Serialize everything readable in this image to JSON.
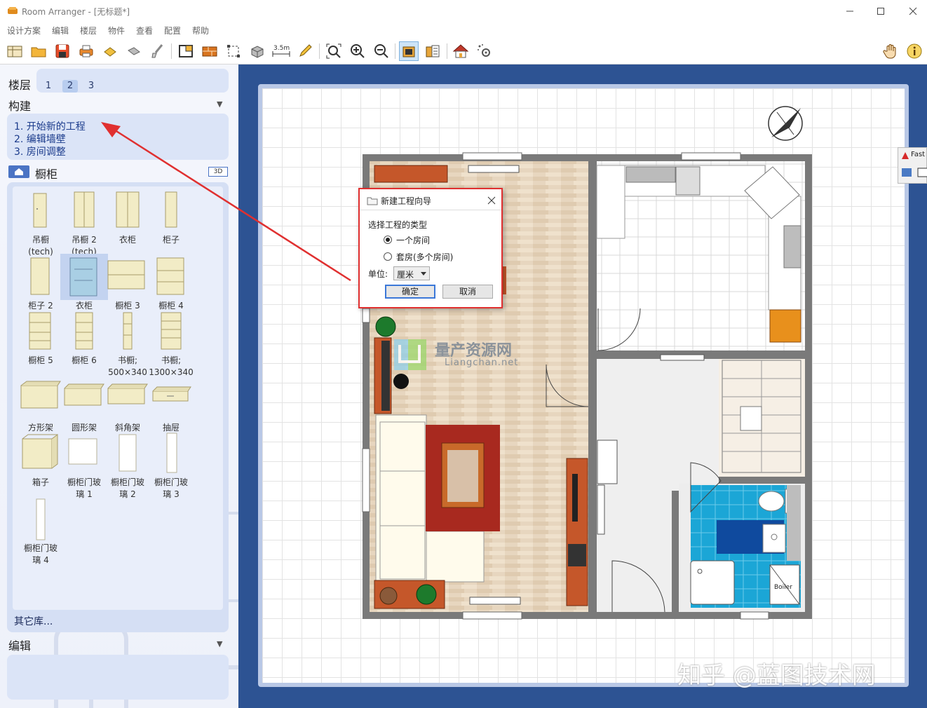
{
  "window": {
    "title": "Room Arranger - [无标题*]"
  },
  "menu": [
    "设计方案",
    "编辑",
    "楼层",
    "物件",
    "查看",
    "配置",
    "帮助"
  ],
  "toolbar": {
    "measure_label": "3.5m"
  },
  "left_panel": {
    "floors": {
      "label": "楼层",
      "tabs": [
        "1",
        "2",
        "3"
      ],
      "selected": "2"
    },
    "build": {
      "label": "构建",
      "steps": [
        "1.  开始新的工程",
        "2.  编辑墙壁",
        "3.  房间调整"
      ]
    },
    "catalog": {
      "label": "橱柜",
      "badge": "3D",
      "items": [
        {
          "label": "吊橱\n(tech)",
          "icon": "hanging-cabinet-icon"
        },
        {
          "label": "吊橱 2\n(tech)",
          "icon": "hanging-cabinet-2-icon"
        },
        {
          "label": "衣柜",
          "icon": "wardrobe-icon"
        },
        {
          "label": "柜子",
          "icon": "cabinet-icon"
        },
        {
          "label": "柜子 2",
          "icon": "cabinet-2-icon"
        },
        {
          "label": "衣柜",
          "icon": "wardrobe-blue-icon",
          "selected": true
        },
        {
          "label": "橱柜 3",
          "icon": "cupboard-3-icon"
        },
        {
          "label": "橱柜 4",
          "icon": "cupboard-4-icon"
        },
        {
          "label": "橱柜 5",
          "icon": "cupboard-5-icon"
        },
        {
          "label": "橱柜 6",
          "icon": "cupboard-6-icon"
        },
        {
          "label": "书橱;\n500×340",
          "icon": "bookcase-500-icon"
        },
        {
          "label": "书橱;\n1300×340",
          "icon": "bookcase-1300-icon"
        },
        {
          "label": "方形架",
          "icon": "square-shelf-icon"
        },
        {
          "label": "圆形架",
          "icon": "round-shelf-icon"
        },
        {
          "label": "斜角架",
          "icon": "corner-shelf-icon"
        },
        {
          "label": "抽屉",
          "icon": "drawer-icon"
        },
        {
          "label": "箱子",
          "icon": "box-icon"
        },
        {
          "label": "橱柜门玻\n璃 1",
          "icon": "glass-door-1-icon"
        },
        {
          "label": "橱柜门玻\n璃 2",
          "icon": "glass-door-2-icon"
        },
        {
          "label": "橱柜门玻\n璃 3",
          "icon": "glass-door-3-icon"
        },
        {
          "label": "橱柜门玻\n璃 4",
          "icon": "glass-door-4-icon"
        }
      ],
      "more": "其它库..."
    },
    "edit": {
      "label": "编辑"
    }
  },
  "dialog": {
    "title": "新建工程向导",
    "prompt": "选择工程的类型",
    "options": [
      "一个房间",
      "套房(多个房间)"
    ],
    "selected_option": "一个房间",
    "unit_label": "单位:",
    "unit_value": "厘米",
    "ok": "确定",
    "cancel": "取消"
  },
  "floorplan": {
    "boiler_label": "Boiler"
  },
  "watermarks": {
    "logo_cn": "量产资源网",
    "logo_en": "Liangchan.net",
    "zhihu": "知乎 @蓝图技术网"
  },
  "side_popup": {
    "label": "Fast"
  },
  "colors": {
    "canvas_bg": "#2d5393",
    "panel_box": "#dbe4f7",
    "annotation_red": "#e03030"
  }
}
